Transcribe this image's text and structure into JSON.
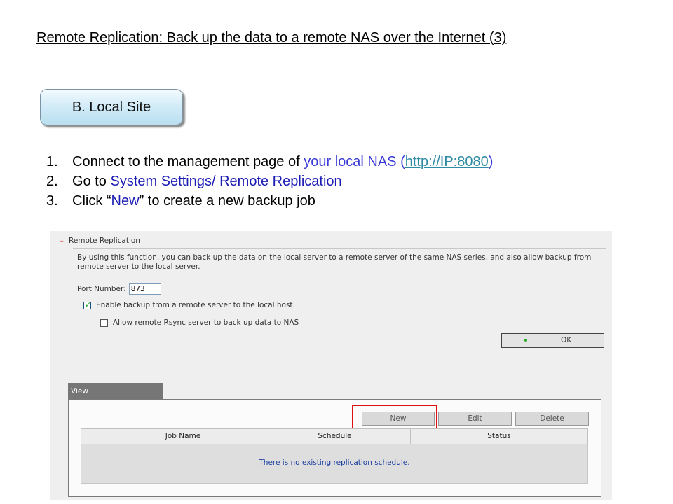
{
  "slide": {
    "title": "Remote Replication: Back up the data to a remote NAS over the Internet (3)",
    "site_label": "B. Local Site",
    "steps": [
      {
        "num": "1.",
        "a": "Connect to the management page of ",
        "b": "your local NAS",
        "c": " (",
        "link": "http://IP:8080",
        "d": ")"
      },
      {
        "num": "2.",
        "a": "Go to ",
        "b": "System Settings/ Remote Replication"
      },
      {
        "num": "3.",
        "a": "Click “",
        "b": "New",
        "c": "” to create a new backup job"
      }
    ]
  },
  "screenshot": {
    "section_title": "Remote Replication",
    "description": "By using this function, you can back up the data on the local server to a remote server of the same NAS series, and also allow backup from remote server to the local server.",
    "port_label": "Port Number:",
    "port_value": "873",
    "enable_backup_label": "Enable backup from a remote server to the local host.",
    "enable_backup_checked": true,
    "allow_rsync_label": "Allow remote Rsync server to back up data to NAS",
    "allow_rsync_checked": false,
    "ok_label": "OK",
    "view_tab": "View",
    "buttons": {
      "new": "New",
      "edit": "Edit",
      "delete": "Delete"
    },
    "table": {
      "columns": [
        "",
        "Job Name",
        "Schedule",
        "Status"
      ],
      "empty_message": "There is no existing replication schedule."
    }
  },
  "colors": {
    "highlight_blue": "#3a3ad6",
    "link": "#2e8ba3",
    "red_highlight": "#e01010",
    "badge_fill": "#b9dff0"
  }
}
